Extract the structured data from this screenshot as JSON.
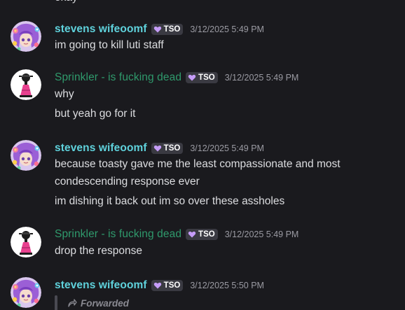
{
  "top_fragment": "okay",
  "tag_label": "TSO",
  "colors": {
    "stevens_name": "#5fd2dc",
    "sprinkler_name": "#2f9a6c",
    "message_text": "#dcdde0",
    "timestamp": "#9a9aa2",
    "background": "#1a1a1e",
    "tag_heart": "#c59cf7"
  },
  "messages": [
    {
      "author": "stevens wifeoomf",
      "timestamp": "3/12/2025 5:49 PM",
      "lines": [
        "im going to kill luti staff"
      ]
    },
    {
      "author": "Sprinkler - is fucking dead",
      "timestamp": "3/12/2025 5:49 PM",
      "lines": [
        "why",
        "but yeah go for it"
      ]
    },
    {
      "author": "stevens wifeoomf",
      "timestamp": "3/12/2025 5:49 PM",
      "lines": [
        "because toasty gave me the least compassionate and most",
        "condescending response ever",
        "im dishing it back out im so over these assholes"
      ]
    },
    {
      "author": "Sprinkler - is fucking dead",
      "timestamp": "3/12/2025 5:49 PM",
      "lines": [
        "drop the response"
      ]
    },
    {
      "author": "stevens wifeoomf",
      "timestamp": "3/12/2025 5:50 PM",
      "forwarded_label": "Forwarded"
    }
  ]
}
